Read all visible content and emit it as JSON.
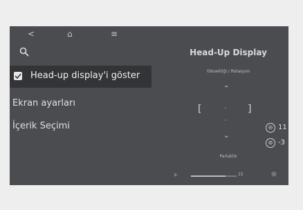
{
  "nav": {
    "back_icon": "<",
    "home_icon": "⌂",
    "menu_icon": "≡"
  },
  "search": {
    "icon": "search-icon"
  },
  "menu": {
    "selected": {
      "label": "Head-up display'i göster",
      "checked": true
    },
    "items": [
      {
        "label": "Ekran ayarları"
      },
      {
        "label": "İçerik Seçimi"
      }
    ]
  },
  "panel": {
    "title": "Head-Up Display",
    "subtitle": "Yüksekliği / Rotasyon",
    "up_arrow": "⌃",
    "down_arrow": "⌄",
    "left_bracket": "[",
    "right_bracket": "]",
    "height_value": "11",
    "rotation_value": "-3",
    "height_icon": "⊝",
    "rotation_icon": "⊘",
    "brightness_label": "Parlaklık",
    "brightness_value": "15",
    "brightness_max": 20,
    "dim_icon": "☀",
    "bright_icon": "☼"
  }
}
